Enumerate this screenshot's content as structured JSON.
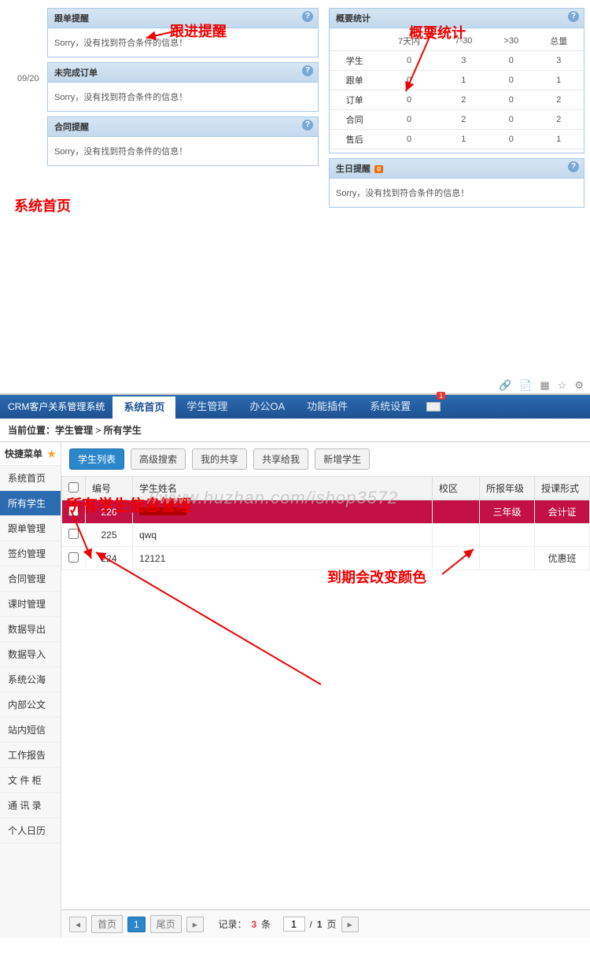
{
  "top": {
    "panels": {
      "follow": {
        "title": "跟单提醒",
        "msg": "Sorry，没有找到符合条件的信息！"
      },
      "unfinished": {
        "title": "未完成订单",
        "msg": "Sorry，没有找到符合条件的信息！"
      },
      "contract": {
        "title": "合同提醒",
        "msg": "Sorry，没有找到符合条件的信息！"
      },
      "birthday": {
        "title": "生日提醒",
        "badge": "0",
        "msg": "Sorry，没有找到符合条件的信息！"
      }
    },
    "date_badge": "09/20",
    "stats": {
      "title": "概要统计",
      "headers": [
        "",
        "7天内",
        "7-30",
        ">30",
        "总量"
      ],
      "rows": [
        {
          "label": "学生",
          "v": [
            "0",
            "3",
            "0",
            "3"
          ]
        },
        {
          "label": "跟单",
          "v": [
            "0",
            "1",
            "0",
            "1"
          ]
        },
        {
          "label": "订单",
          "v": [
            "0",
            "2",
            "0",
            "2"
          ]
        },
        {
          "label": "合同",
          "v": [
            "0",
            "2",
            "0",
            "2"
          ]
        },
        {
          "label": "售后",
          "v": [
            "0",
            "1",
            "0",
            "1"
          ]
        }
      ]
    },
    "anno": {
      "follow": "跟进提醒",
      "stats": "概要统计",
      "home": "系统首页"
    }
  },
  "bottom": {
    "brand": "CRM客户关系管理系统",
    "nav": {
      "home": "系统首页",
      "student": "学生管理",
      "oa": "办公OA",
      "plugin": "功能插件",
      "setting": "系统设置"
    },
    "mail_badge": "1",
    "breadcrumb": {
      "prefix": "当前位置：",
      "p1": "学生管理",
      "sep": " > ",
      "p2": "所有学生"
    },
    "sidebar": {
      "header": "快捷菜单",
      "items": [
        "系统首页",
        "所有学生",
        "跟单管理",
        "签约管理",
        "合同管理",
        "课时管理",
        "数据导出",
        "数据导入",
        "系统公海",
        "内部公文",
        "站内短信",
        "工作报告",
        "文 件 柜",
        "通 讯 录",
        "个人日历"
      ]
    },
    "buttons": {
      "list": "学生列表",
      "adv": "高级搜索",
      "mine": "我的共享",
      "shared": "共享给我",
      "add": "新增学生"
    },
    "watermark_cn": "所有学生信息管理",
    "watermark_url": "//www.huzhan.com/ishop3572",
    "table": {
      "headers": {
        "id": "编号",
        "name": "学生姓名",
        "campus": "校区",
        "grade": "所报年级",
        "form": "授课形式"
      },
      "rows": [
        {
          "id": "226",
          "name": "",
          "campus": "",
          "grade": "三年级",
          "form": "会计证",
          "expired": true
        },
        {
          "id": "225",
          "name": "qwq",
          "campus": "",
          "grade": "",
          "form": "",
          "expired": false
        },
        {
          "id": "224",
          "name": "12121",
          "campus": "",
          "grade": "",
          "form": "优惠班",
          "expired": false
        }
      ]
    },
    "anno": {
      "info": "所有学生信息管理",
      "expired": "到期会改变颜色"
    },
    "footer": {
      "first": "首页",
      "page": "1",
      "last": "尾页",
      "rec_prefix": "记录：",
      "rec_count": "3",
      "rec_unit": " 条",
      "page_input": "1",
      "page_sep": " / ",
      "page_total": "1",
      "page_unit": " 页"
    }
  }
}
